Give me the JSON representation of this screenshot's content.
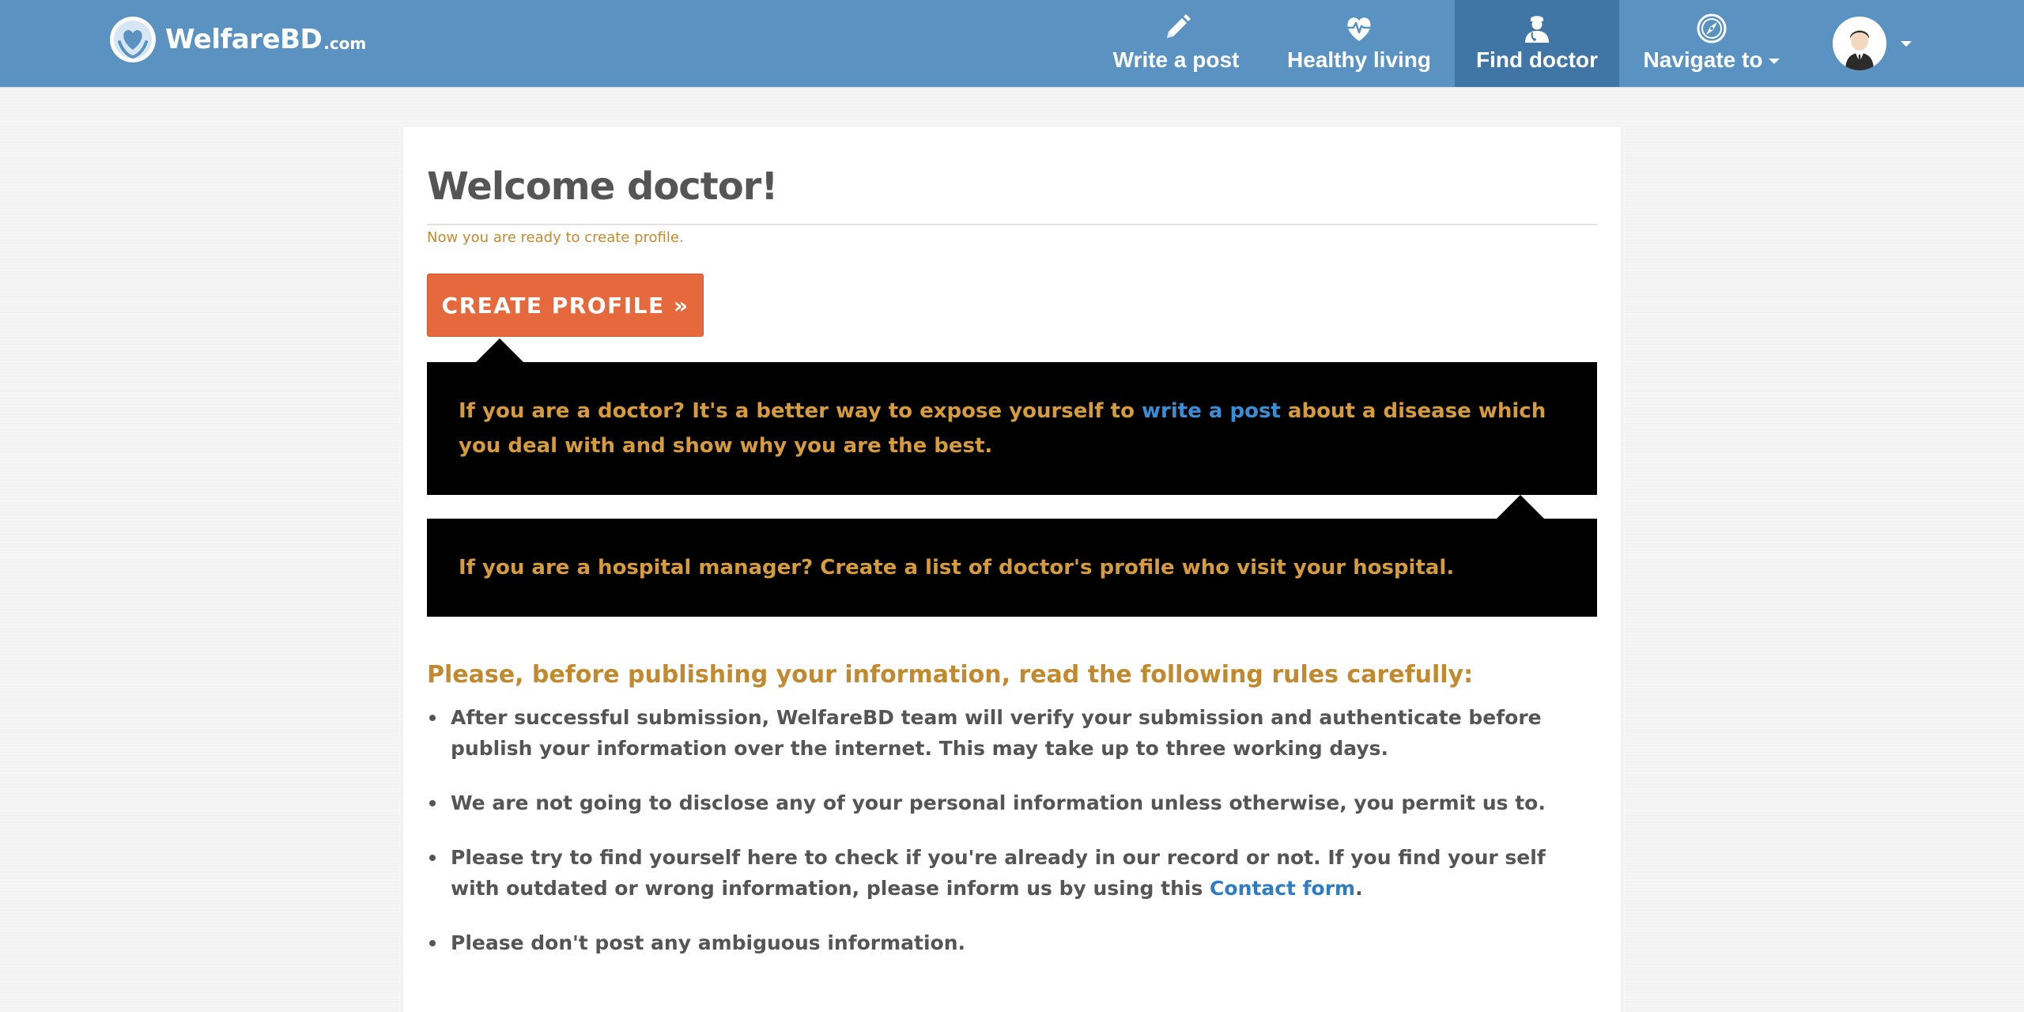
{
  "brand": {
    "name": "WelfareBD",
    "tld": ".com"
  },
  "nav": {
    "items": [
      {
        "label": "Write a post",
        "icon": "pencil-icon"
      },
      {
        "label": "Healthy living",
        "icon": "heart-pulse-icon"
      },
      {
        "label": "Find doctor",
        "icon": "doctor-icon",
        "active": true
      },
      {
        "label": "Navigate to",
        "icon": "compass-icon",
        "dropdown": true
      }
    ],
    "user": {
      "icon": "avatar-icon",
      "dropdown": true
    }
  },
  "main": {
    "title": "Welcome doctor!",
    "subtitle": "Now you are ready to create profile.",
    "create_button": "CREATE PROFILE »",
    "callout_doctor": {
      "text_before": "If you are a doctor? It's a better way to expose yourself to ",
      "link": "write a post",
      "text_after": " about a disease which you deal with and show why you are the best."
    },
    "callout_hospital": "If you are a hospital manager? Create a list of doctor's profile who visit your hospital.",
    "rules_heading": "Please, before publishing your information, read the following rules carefully:",
    "rules": [
      {
        "text": "After successful submission, WelfareBD team will verify your submission and authenticate before publish your information over the internet. This may take up to three working days."
      },
      {
        "text": "We are not going to disclose any of your personal information unless otherwise, you permit us to."
      },
      {
        "text_before": "Please try to find yourself here to check if you're already in our record or not. If you find your self with outdated or wrong information, please inform us by using this ",
        "link": "Contact form",
        "text_after": "."
      },
      {
        "text": "Please don't post any ambiguous information."
      }
    ]
  },
  "colors": {
    "navbar": "#5a92c1",
    "navbar_active": "#3f76a6",
    "accent_button": "#e6693e",
    "gold_text": "#c28a2f",
    "callout_text": "#d69b3a",
    "link": "#2f7cc2",
    "body_text": "#555555"
  }
}
